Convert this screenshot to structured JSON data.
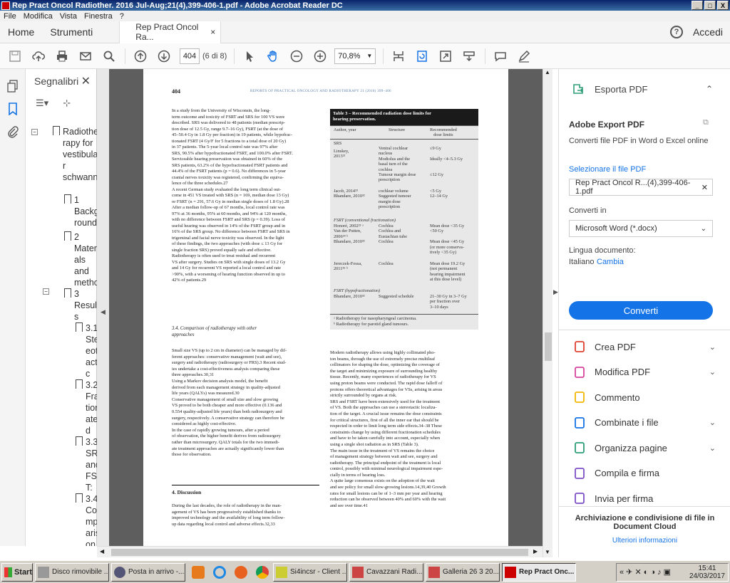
{
  "window": {
    "title": "Rep Pract Oncol Radiother. 2016 Jul-Aug;21(4),399-406-1.pdf - Adobe Acrobat Reader DC",
    "controls": [
      "_",
      "□",
      "X"
    ]
  },
  "menu": [
    "File",
    "Modifica",
    "Vista",
    "Finestra",
    "?"
  ],
  "tabs": {
    "home": "Home",
    "tools": "Strumenti",
    "doc": "Rep Pract Oncol Ra...",
    "close": "×",
    "help": "?",
    "login": "Accedi"
  },
  "toolbar": {
    "page": "404",
    "page_count": "(6 di 8)",
    "zoom": "70,8%"
  },
  "bookmarks": {
    "title": "Segnalibri",
    "close": "✕",
    "items": [
      {
        "lines": [
          "Radiothe",
          "rapy for",
          "vestibula",
          "r",
          "schwann"
        ]
      },
      {
        "lines": [
          "1",
          "Backg",
          "round"
        ]
      },
      {
        "lines": [
          "2",
          "Materi",
          "als",
          "and",
          "metho"
        ]
      },
      {
        "lines": [
          "3",
          "Result",
          "s"
        ]
      },
      {
        "lines": [
          "3.1",
          "Ster",
          "eot",
          "acti",
          "c"
        ]
      },
      {
        "lines": [
          "3.2",
          "Frac",
          "tion",
          "ate",
          "d"
        ]
      },
      {
        "lines": [
          "3.3",
          "SRS",
          "and",
          "FSR",
          "T:"
        ]
      },
      {
        "lines": [
          "3.4",
          "Co",
          "mp",
          "aris",
          "on"
        ]
      }
    ]
  },
  "page": {
    "number": "404",
    "journal": "REPORTS OF PRACTICAL ONCOLOGY AND RADIOTHERAPY 21 (2016) 399–406",
    "left_col_1": [
      "In a study from the University of Wisconsin, the long-",
      "term outcome and toxicity of FSRT and SRS for 100 VS were",
      "described. SRS was delivered to 48 patients (median prescrip-",
      "tion dose of 12.5 Gy, range 9.7–16 Gy), FSRT (at the dose of",
      "45–50.4 Gy in 1.8 Gy per fraction) in 19 patients, while hypofrac-",
      "tionated FSRT (4 Gy/F for 5 fractions to a total dose of 20 Gy)",
      "in 37 patients. The 5-year local control rate was 97% after",
      "SRS, 90.5% after hypofractionated FSRT, and 100.0% after FSRT.",
      "Serviceable hearing preservation was obtained in 60% of the",
      "SRS patients, 63.2% of the hypofractionated FSRT patients and",
      "44.4% of the FSRT patients (p = 0.6). No differences in 5-year",
      "cranial nerves toxicity was registered, confirming the equiva-",
      "lence of the three schedules.27",
      "A recent German study evaluated the long term clinical out-",
      "come in 451 VS treated with SRS (n = 169, median dose 13 Gy)",
      "or FSRT (n = 291, 57.6 Gy in median single doses of 1.8 Gy).28",
      "After a median follow-up of 67 months, local control rate was",
      "97% at 36 months, 95% at 60 months, and 94% at 120 months,",
      "with no difference between FSRT and SRS (p = 0.39). Loss of",
      "useful hearing was observed in 14% of the FSRT group and in",
      "16% of the SRS group. No difference between FSRT and SRS in",
      "trigeminal and facial nerve toxicity was observed. In the light",
      "of these findings, the two approaches (with dose ≤ 13 Gy for",
      "single fraction SRS) proved equally safe and effective.",
      "Radiotherapy is often used to treat residual and recurrent",
      "VS after surgery. Studies on SRS with single doses of 13.2 Gy",
      "and 14 Gy for recurrent VS reported a local control and rate",
      ">90%, with a worsening of hearing function observed in up to",
      "42% of patients.29"
    ],
    "sec34_title": [
      "3.4.     Comparison of radiotherapy with other",
      "approaches"
    ],
    "left_col_2": [
      "Small size VS (up to 2 cm in diameter) can be managed by dif-",
      "ferent approaches: conservative management (wait and see),",
      "surgery and radiotherapy (radiosurgery or FRS).3 Recent stud-",
      "ies undertake a cost-effectiveness analysis comparing these",
      "three approaches.30,31",
      "Using a Markov decision analysis model, the benefit",
      "derived from each management strategy in quality-adjusted",
      "life years (QALYs) was measured.30",
      "Conservative management of small size and slow growing",
      "VS proved to be both cheaper and more effective (0.136 and",
      "0.554 quality-adjusted life years) than both radiosurgery and",
      "surgery, respectively. A conservative strategy can therefore be",
      "considered as highly cost-effective.",
      "In the case of rapidly growing tumours, after a period",
      "of observation, the higher benefit derives from radiosurgery",
      "rather than microsurgery. QALY totals for the two immedi-",
      "ate treatment approaches are actually significantly lower than",
      "those for observation."
    ],
    "discussion_title": "4.       Discussion",
    "left_col_3": [
      "During the last decades, the role of radiotherapy in the man-",
      "agement of VS has been progressively established thanks to",
      "improved technology and the availability of long term follow-",
      "up data regarding local control and adverse effects.32,33"
    ],
    "right_col": [
      "Modern radiotherapy allows using highly collimated pho-",
      "ton beams, through the use of extremely precise multileaf",
      "collimators for shaping the dose, optimizing the coverage of",
      "the target and minimizing exposure of surrounding healthy",
      "tissue. Recently, many experiences of radiotherapy for VS",
      "using proton beams were conducted. The rapid dose falloff of",
      "protons offers theoretical advantages for VSs, arising in areas",
      "strictly surrounded by organs at risk.",
      "SRS and FSRT have been extensively used for the treatment",
      "of VS. Both the approaches can use a stereotactic localiza-",
      "tion of the target. A crucial issue remains the dose constraints",
      "for critical structures, first of all the inner ear that should be",
      "respected in order to limit long term side effects.34–38 These",
      "constraints change by using different fractionation schedules",
      "and have to be taken carefully into account, especially when",
      "using a single shot radiation as in SRS (Table 3).",
      "The main issue in the treatment of VS remains the choice",
      "of management strategy between wait and see, surgery and",
      "radiotherapy. The principal endpoint of the treatment is local",
      "control, possibly with minimal neurological impairment espe-",
      "cially in terms of hearing loss.",
      "A quite large consensus exists on the adoption of the wait",
      "and see policy for small slow-growing lesions.14,39,40 Growth",
      "rates for small lesions can be of 1–3 mm per year and hearing",
      "reduction can be observed between 40% and 60% with the wait",
      "and see over time.41"
    ],
    "table": {
      "title": [
        "Table 3 – Recommended radiation dose limits for",
        "hearing preservation."
      ],
      "headers": [
        "Author, year",
        "Structure",
        "Recommended\ndose limits"
      ],
      "section_srs": "SRS",
      "rows": [
        {
          "author": "Linskey,\n2013²¹",
          "structure": "Ventral cochlear\nnucleus\nModiolus and the\nbasal turn of the\ncochlea\nTumour margin dose\nprescription",
          "limits": "≤9 Gy\n\nIdeally <4–5.3 Gy\n\n\n≤12 Gy"
        },
        {
          "author": "Jacob, 2014²³\nBhandare, 2010³²",
          "structure": "cochlear volume\nSuggested tumour\nmargin dose\nprescription",
          "limits": "<5 Gy\n12–14 Gy"
        }
      ],
      "section_fsrt": "FSRT (conventional fractionation)",
      "rows2": [
        {
          "author": "Honoré, 2002²³ ᵃ\nVan der Putten,\n2006²⁴ ᵇ\nBhandare, 2010³²",
          "structure": "Cochlea\nCochlea and\nEustachian tube\nCochlea",
          "limits": "Mean dose <35 Gy\n<50 Gy\n\nMean dose <45 Gy\n(or more conserva-\ntively <35 Gy)"
        },
        {
          "author": "Jereczek-Fossa,\n2011³⁵ ᵇ",
          "structure": "Cochlea",
          "limits": "Mean dose 19.2 Gy\n(not permanent\nhearing impairment\nat this dose level)"
        }
      ],
      "section_hypo": "FSRT (hypofractionation)",
      "rows3": [
        {
          "author": "Bhandare, 2010³²",
          "structure": "Suggested schedule",
          "limits": "21–30 Gy in 3–7 Gy\nper fraction over\n3–10 days"
        }
      ],
      "footnotes": [
        "ᵃ Radiotherapy for nasopharyngeal carcinoma.",
        "ᵇ Radiotherapy for parotid gland tumours."
      ]
    }
  },
  "rightpane": {
    "export_title": "Esporta PDF",
    "adobe_export": "Adobe Export PDF",
    "convert_desc": "Converti file PDF in Word o Excel online",
    "select_label": "Selezionare il file PDF",
    "selected_file": "Rep Pract Oncol R...(4),399-406-1.pdf",
    "convert_in_label": "Converti in",
    "format": "Microsoft Word (*.docx)",
    "lang_label": "Lingua documento:",
    "lang_value": "Italiano",
    "lang_change": "Cambia",
    "convert_btn": "Converti",
    "tools": [
      "Crea PDF",
      "Modifica PDF",
      "Commento",
      "Combinate i file",
      "Organizza pagine",
      "Compila e firma",
      "Invia per firma"
    ],
    "tool_colors": [
      "#e0402f",
      "#d6449c",
      "#f2b600",
      "#1473e6",
      "#2d9d78",
      "#7d4fc6",
      "#7d4fc6"
    ],
    "cloud_title": "Archiviazione e condivisione di file in Document Cloud",
    "cloud_link": "Ulteriori informazioni"
  },
  "taskbar": {
    "start": "Start",
    "tasks": [
      "Disco rimovibile ...",
      "Posta in arrivo -...",
      "Si4incsr - Client ...",
      "Cavazzani Radi...",
      "Galleria 26 3 20...",
      "Rep Pract Onc..."
    ],
    "time": "15:41",
    "date": "24/03/2017"
  }
}
